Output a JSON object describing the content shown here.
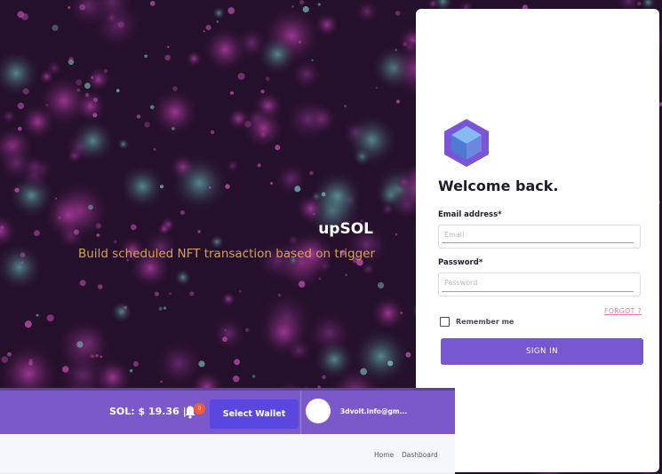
{
  "hero": {
    "title": "upSOL",
    "subtitle": "Build scheduled NFT transaction based on trigger"
  },
  "login": {
    "heading": "Welcome back.",
    "email_label": "Email address*",
    "email_placeholder": "Email",
    "email_value": "",
    "password_label": "Password*",
    "password_placeholder": "Password",
    "password_value": "",
    "remember_label": "Remember me",
    "forgot_label": "FORGOT ?",
    "signin_label": "SIGN IN"
  },
  "navbar": {
    "balance": "SOL: $ 19.36 |",
    "notification_count": "0",
    "wallet_button": "Select Wallet",
    "account": "3dvolt.info@gm..."
  },
  "breadcrumb": {
    "home": "Home",
    "dashboard": "Dashboard"
  },
  "icons": {
    "logo": "hexagon-cube-logo",
    "bell": "bell-icon"
  },
  "colors": {
    "accent": "#7757cf",
    "navbar": "#7b59cb",
    "wallet_button": "#5a47e0",
    "hero_subtitle": "#d7a24a",
    "forgot_link": "#e27aa8",
    "badge": "#f05a3a"
  }
}
